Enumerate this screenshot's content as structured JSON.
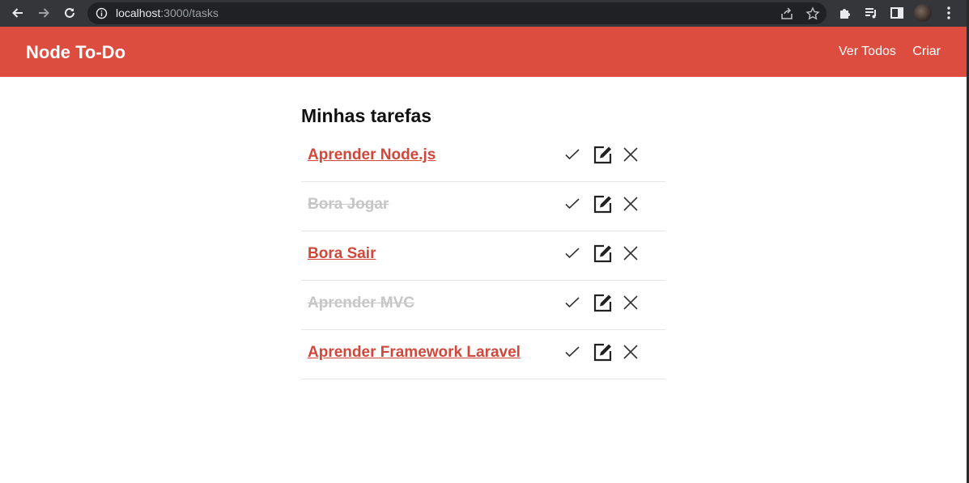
{
  "browser": {
    "url_host": "localhost",
    "url_path": ":3000/tasks"
  },
  "app": {
    "brand": "Node To-Do",
    "nav": [
      {
        "label": "Ver Todos"
      },
      {
        "label": "Criar"
      }
    ],
    "accent_color": "#dc4c3f"
  },
  "page": {
    "title": "Minhas tarefas"
  },
  "tasks": [
    {
      "title": "Aprender Node.js",
      "done": false
    },
    {
      "title": "Bora Jogar",
      "done": true
    },
    {
      "title": "Bora Sair",
      "done": false
    },
    {
      "title": "Aprender MVC",
      "done": true
    },
    {
      "title": "Aprender Framework Laravel",
      "done": false
    }
  ],
  "icons": {
    "complete": "check-icon",
    "edit": "edit-icon",
    "delete": "close-icon"
  }
}
